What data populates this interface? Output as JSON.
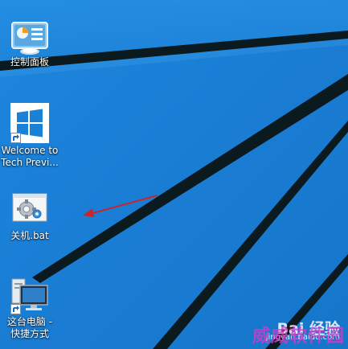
{
  "desktop": {
    "wallpaper_color": "#1b7fd6",
    "icons": [
      {
        "label": "控制面板",
        "icon": "control-panel-icon"
      },
      {
        "label": "Welcome to\nTech Previ...",
        "icon": "windows-logo-icon"
      },
      {
        "label": "关机.bat",
        "icon": "batch-file-icon"
      },
      {
        "label": "这台电脑 -\n快捷方式",
        "icon": "this-pc-icon"
      }
    ]
  },
  "annotation": {
    "arrow_color": "#c8262c"
  },
  "watermark": {
    "brand": "Bai 经验",
    "url": "jingyan.baidu.com",
    "site": "威威软件园",
    "site_color": "#d23cc8"
  }
}
